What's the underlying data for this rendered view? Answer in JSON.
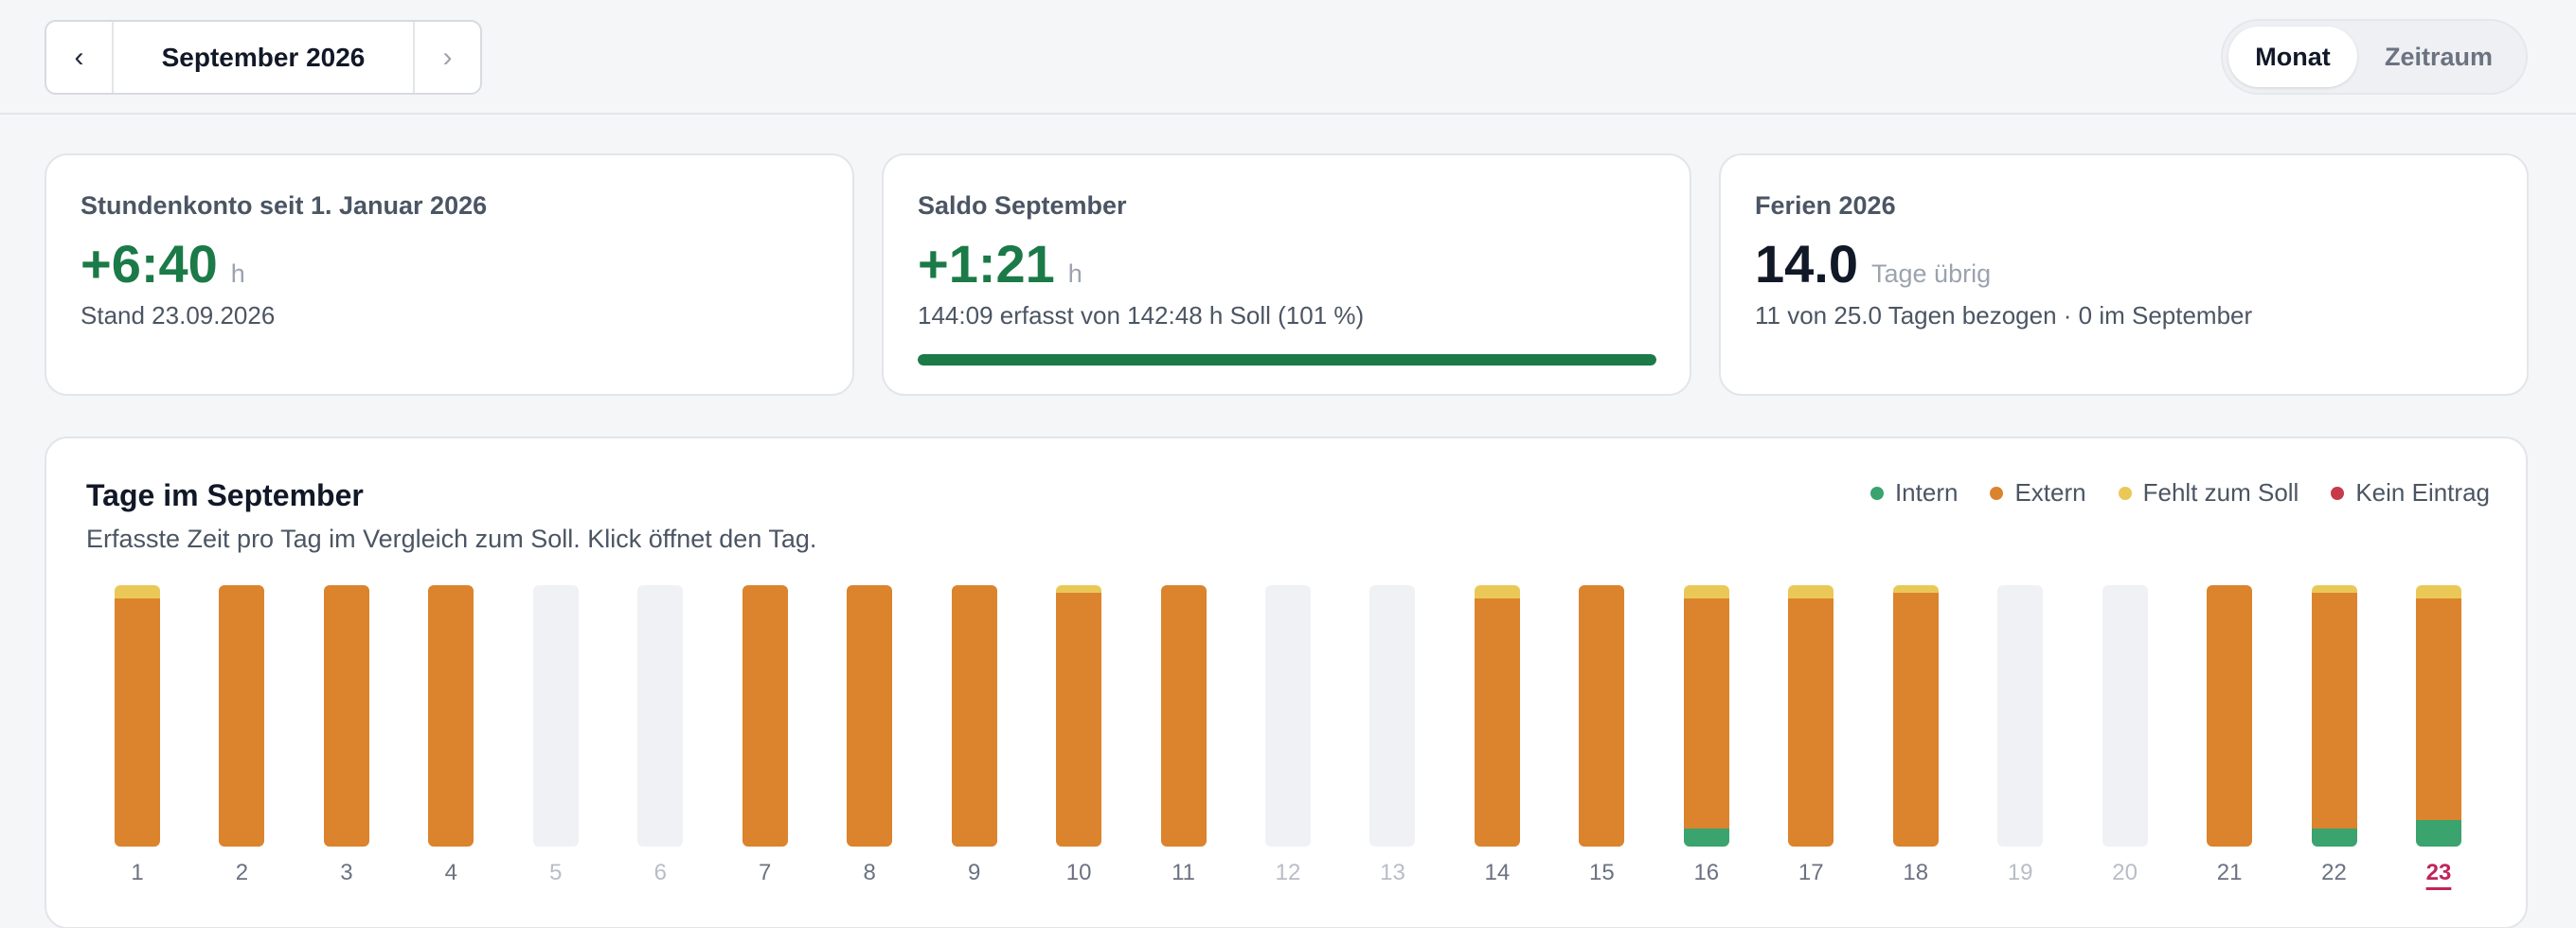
{
  "navigation": {
    "prev_icon": "chevron-left-icon",
    "prev_glyph": "‹",
    "month_label": "September 2026",
    "next_icon": "chevron-right-icon",
    "next_glyph": "›"
  },
  "view_toggle": {
    "options": [
      "Monat",
      "Zeitraum"
    ],
    "active": "Monat"
  },
  "cards": {
    "hours_account": {
      "title": "Stundenkonto seit 1. Januar 2026",
      "value": "+6:40",
      "unit": "h",
      "sub": "Stand 23.09.2026"
    },
    "balance": {
      "title": "Saldo September",
      "value": "+1:21",
      "unit": "h",
      "sub": "144:09 erfasst von 142:48 h Soll (101 %)",
      "progress_percent": 101
    },
    "vacation": {
      "title": "Ferien 2026",
      "value": "14.0",
      "unit": "Tage übrig",
      "sub": "11 von 25.0 Tagen bezogen · 0 im September"
    }
  },
  "chart": {
    "title": "Tage im September",
    "subtitle": "Erfasste Zeit pro Tag im Vergleich zum Soll. Klick öffnet den Tag.",
    "legend": [
      {
        "label": "Intern",
        "color": "#3aa36e"
      },
      {
        "label": "Extern",
        "color": "#db832d"
      },
      {
        "label": "Fehlt zum Soll",
        "color": "#eac857"
      },
      {
        "label": "Kein Eintrag",
        "color": "#c73a4a"
      }
    ]
  },
  "chart_data": {
    "type": "bar",
    "stacked": true,
    "categories": [
      "1",
      "2",
      "3",
      "4",
      "5",
      "6",
      "7",
      "8",
      "9",
      "10",
      "11",
      "12",
      "13",
      "14",
      "15",
      "16",
      "17",
      "18",
      "19",
      "20",
      "21",
      "22",
      "23"
    ],
    "series": [
      {
        "name": "Intern",
        "color": "#3aa36e",
        "values": [
          0,
          0,
          0,
          0,
          0,
          0,
          0,
          0,
          0,
          0,
          0,
          0,
          0,
          0,
          0,
          0.07,
          0,
          0,
          0,
          0,
          0,
          0.07,
          0.1
        ]
      },
      {
        "name": "Extern",
        "color": "#db832d",
        "values": [
          0.95,
          1,
          1,
          1,
          0,
          0,
          1,
          1,
          1,
          0.97,
          1,
          0,
          0,
          0.95,
          1,
          0.88,
          0.95,
          0.97,
          0,
          0,
          1,
          0.9,
          0.85
        ]
      },
      {
        "name": "Fehlt zum Soll",
        "color": "#eac857",
        "values": [
          0.05,
          0,
          0,
          0,
          0,
          0,
          0,
          0,
          0,
          0.03,
          0,
          0,
          0,
          0.05,
          0,
          0.05,
          0.05,
          0.03,
          0,
          0,
          0,
          0.03,
          0.05
        ]
      }
    ],
    "no_work_days": [
      "5",
      "6",
      "12",
      "13",
      "19",
      "20"
    ],
    "today": "23",
    "ylim": [
      0,
      1
    ],
    "grid": false,
    "legend_position": "top-right"
  }
}
